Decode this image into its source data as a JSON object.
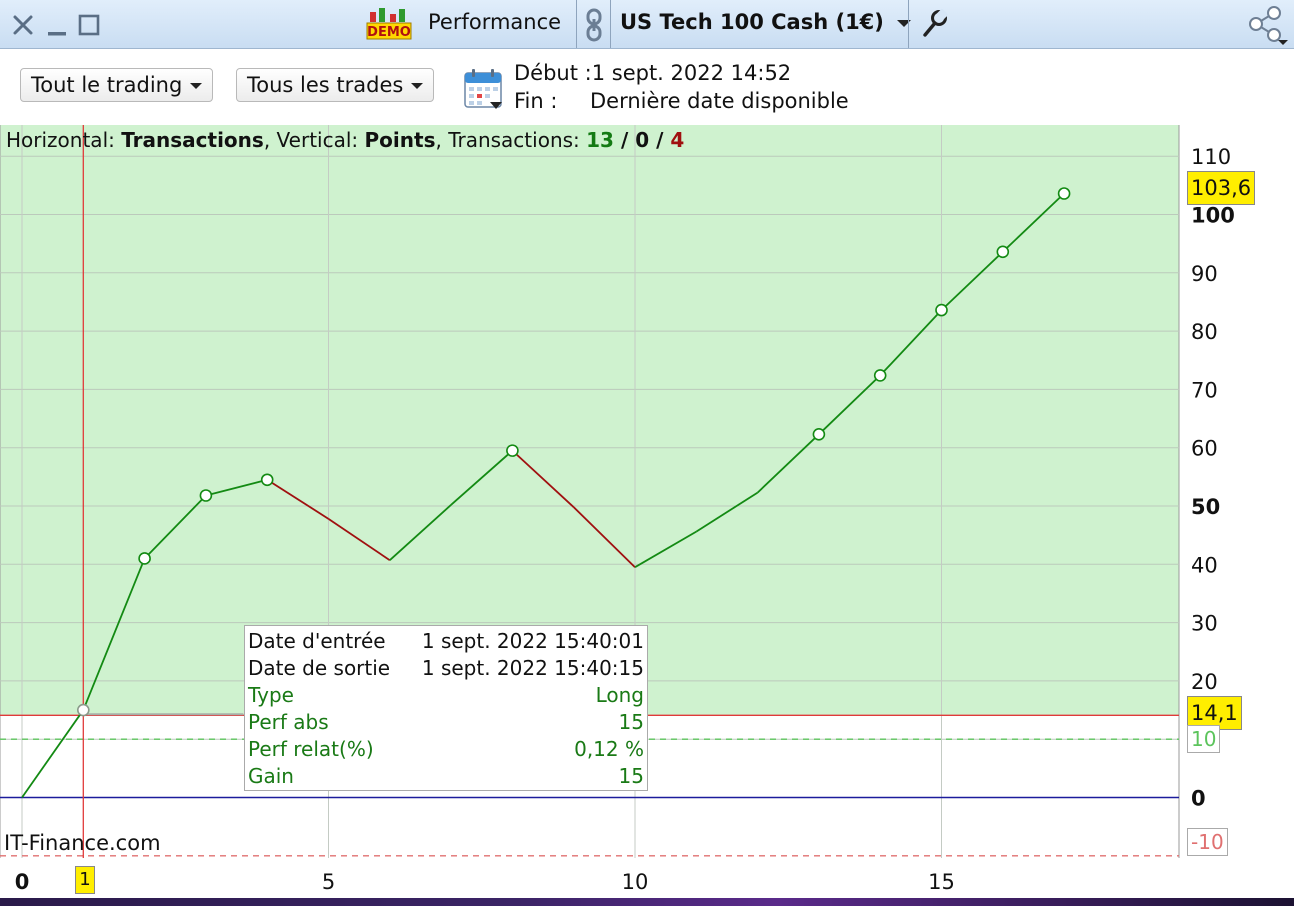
{
  "titlebar": {
    "demo_badge": "DEMO",
    "performance_label": "Performance",
    "instrument_label": "US Tech 100 Cash (1€)",
    "icons": [
      "close-icon",
      "minimize-icon",
      "maximize-icon",
      "demo-icon",
      "link-icon",
      "chevron-down-icon",
      "wrench-icon",
      "share-icon"
    ]
  },
  "toolbar": {
    "scope_dropdown": "Tout le trading",
    "trades_dropdown": "Tous les trades",
    "calendar_icon": "calendar-icon",
    "start_label": "Début :",
    "start_value": "1 sept. 2022 14:52",
    "end_label": "Fin :",
    "end_value": "Dernière date disponible"
  },
  "chart_header": {
    "horizontal_label": "Horizontal: ",
    "horizontal_value": "Transactions",
    "vertical_label": ", Vertical: ",
    "vertical_value": "Points",
    "transactions_label": ", Transactions: ",
    "winning": "13",
    "sep1": " / ",
    "neutral": "0",
    "sep2": " / ",
    "losing": "4"
  },
  "tooltip": {
    "rows": [
      {
        "key": "Date d'entrée",
        "value": "1 sept. 2022 15:40:01"
      },
      {
        "key": "Date de sortie",
        "value": "1 sept. 2022 15:40:15"
      },
      {
        "key": "Type",
        "value": "Long"
      },
      {
        "key": "Perf abs",
        "value": "15"
      },
      {
        "key": "Perf relat(%)",
        "value": "0,12 %"
      },
      {
        "key": "Gain",
        "value": "15"
      }
    ]
  },
  "watermark": "IT-Finance.com",
  "badges": {
    "last_value": "103,6",
    "cursor_value": "14,1",
    "upper_level": "10",
    "lower_level": "-10",
    "cursor_x": "1"
  },
  "colors": {
    "profit_zone": "#cff2cf",
    "up_line": "#138a13",
    "down_line": "#a01010",
    "zero_line": "#1c1c9c",
    "cursor": "#e03a3a",
    "badge": "#ffee00",
    "upper_level": "#5cc45c",
    "lower_level": "#e07070"
  },
  "chart_data": {
    "type": "line",
    "x": [
      0,
      1,
      2,
      3,
      4,
      5,
      6,
      7,
      8,
      9,
      10,
      11,
      12,
      13,
      14,
      15,
      16,
      17
    ],
    "y": [
      0,
      15,
      41,
      51.8,
      54.5,
      47.8,
      40.7,
      50.2,
      59.5,
      49.8,
      39.5,
      45.6,
      52.3,
      62.3,
      72.4,
      83.6,
      93.6,
      103.6
    ],
    "markers_at_x": [
      1,
      2,
      3,
      4,
      8,
      13,
      14,
      15,
      16,
      17
    ],
    "direction": [
      "up",
      "up",
      "up",
      "up",
      "down",
      "down",
      "up",
      "up",
      "down",
      "down",
      "up",
      "up",
      "up",
      "up",
      "up",
      "up",
      "up"
    ],
    "x_ticks": [
      "0",
      "5",
      "10",
      "15"
    ],
    "x_tick_values": [
      0,
      5,
      10,
      15
    ],
    "y_ticks": [
      "-10",
      "0",
      "10",
      "20",
      "30",
      "40",
      "50",
      "60",
      "70",
      "80",
      "90",
      "100",
      "110"
    ],
    "y_tick_values": [
      0,
      10,
      20,
      30,
      40,
      50,
      60,
      70,
      80,
      90,
      100,
      110
    ],
    "y_tick_labels": [
      "0",
      "20",
      "30",
      "40",
      "50",
      "60",
      "70",
      "80",
      "90",
      "100",
      "110"
    ],
    "bold_y_ticks": [
      0,
      50,
      100
    ],
    "xlim": [
      -0.05,
      18.5
    ],
    "ylim": [
      -10,
      112
    ],
    "cursor": {
      "x": 1,
      "y": 14.1
    },
    "levels": {
      "upper": 10,
      "lower": -10
    },
    "grid": true,
    "profit_zone_above": 14.1
  }
}
